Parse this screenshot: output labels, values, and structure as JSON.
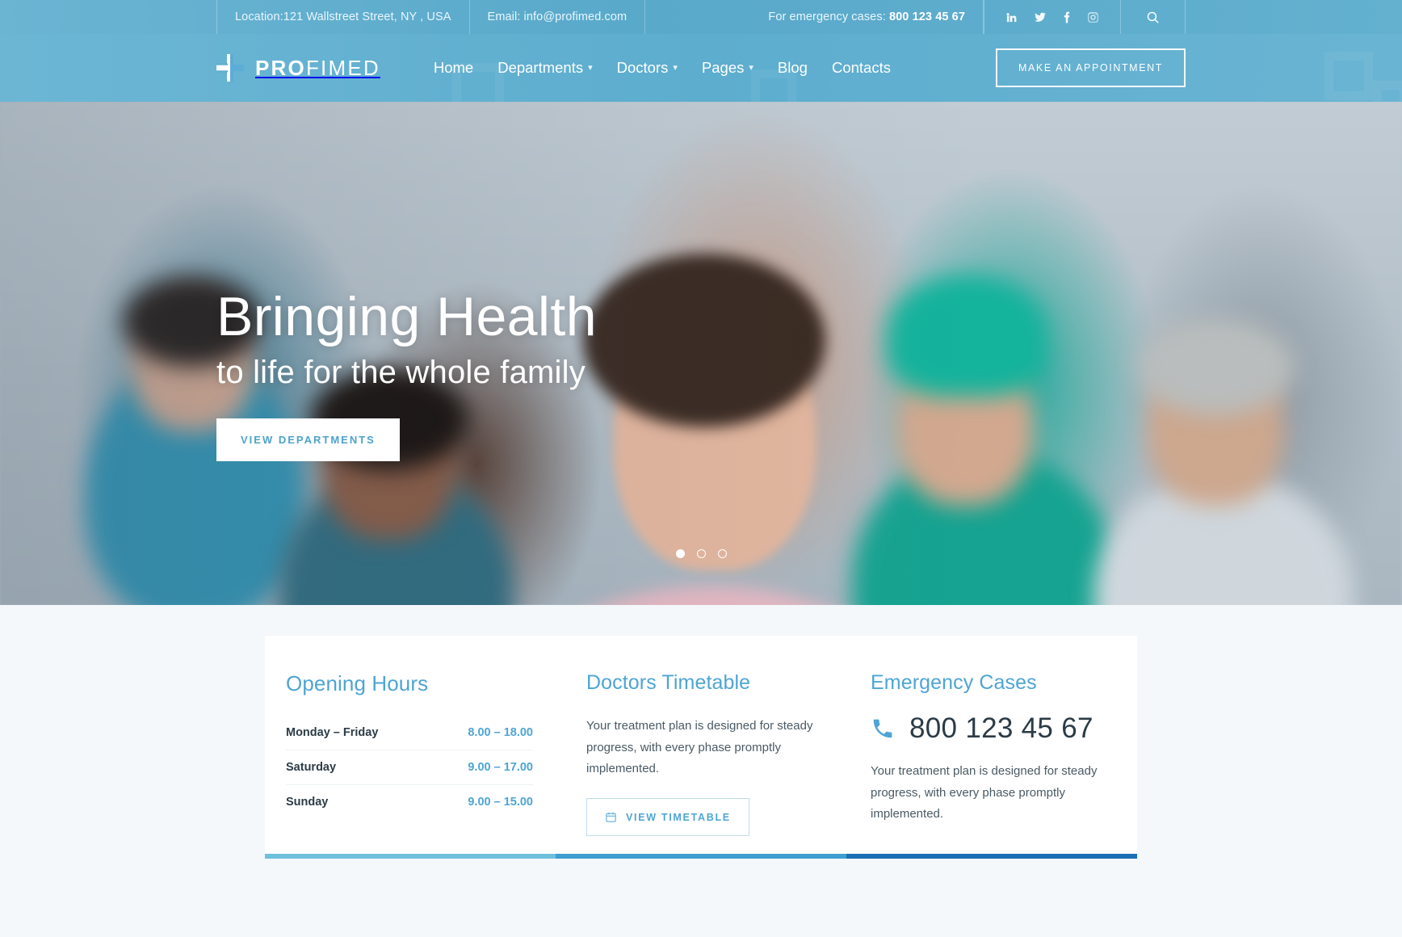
{
  "topbar": {
    "location": "Location:121 Wallstreet Street, NY , USA",
    "email": "Email: info@profimed.com",
    "emergency_label": "For emergency cases:",
    "emergency_phone": "800 123 45 67",
    "social": [
      "linkedin-icon",
      "twitter-icon",
      "facebook-icon",
      "instagram-icon"
    ],
    "search_icon": "search-icon"
  },
  "header": {
    "brand_bold": "PRO",
    "brand_light": "FIMED",
    "logo_icon": "medical-cross-icon",
    "nav": [
      {
        "label": "Home",
        "has_caret": false,
        "active": true
      },
      {
        "label": "Departments",
        "has_caret": true,
        "active": false
      },
      {
        "label": "Doctors",
        "has_caret": true,
        "active": false
      },
      {
        "label": "Pages",
        "has_caret": true,
        "active": false
      },
      {
        "label": "Blog",
        "has_caret": false,
        "active": false
      },
      {
        "label": "Contacts",
        "has_caret": false,
        "active": false
      }
    ],
    "cta_label": "MAKE AN APPOINTMENT"
  },
  "hero": {
    "headline": "Bringing Health",
    "subheadline": "to life for the whole family",
    "button_label": "VIEW DEPARTMENTS",
    "slides": 3,
    "active_slide": 1
  },
  "info": {
    "opening_hours": {
      "title": "Opening Hours",
      "rows": [
        {
          "day": "Monday – Friday",
          "time": "8.00 – 18.00"
        },
        {
          "day": "Saturday",
          "time": "9.00 – 17.00"
        },
        {
          "day": "Sunday",
          "time": "9.00 – 15.00"
        }
      ]
    },
    "timetable": {
      "title": "Doctors Timetable",
      "text": "Your treatment plan is designed for steady progress, with every phase promptly implemented.",
      "button_label": "VIEW TIMETABLE",
      "button_icon": "calendar-icon"
    },
    "emergency": {
      "title": "Emergency Cases",
      "phone_icon": "phone-icon",
      "phone": "800 123 45 67",
      "text": "Your treatment plan is designed for steady progress, with every phase promptly implemented."
    }
  },
  "colors": {
    "brand_blue": "#4ea5d4",
    "header_blue": "#63b1d2",
    "bar_light": "#6fc0dd",
    "bar_mid": "#3f9ed0",
    "bar_dark": "#1b6fb5"
  }
}
